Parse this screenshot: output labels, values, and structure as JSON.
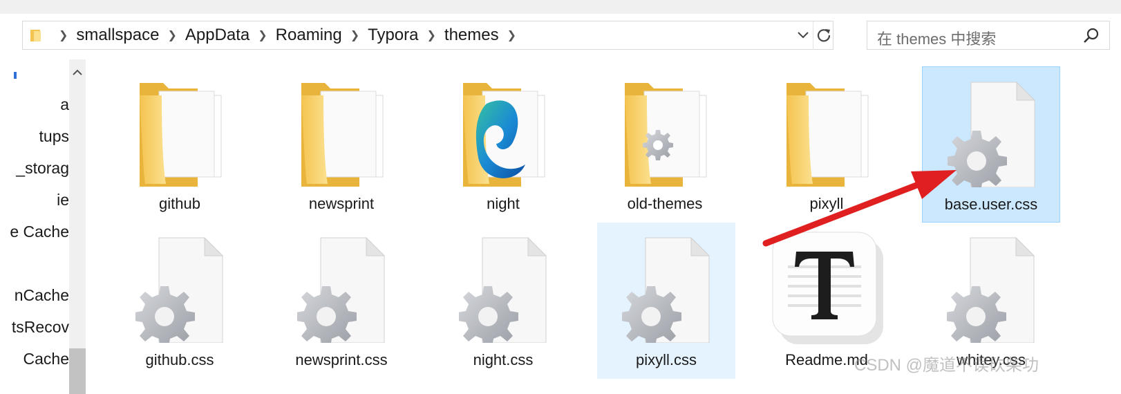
{
  "address_bar": {
    "breadcrumbs": [
      "smallspace",
      "AppData",
      "Roaming",
      "Typora",
      "themes"
    ]
  },
  "search": {
    "placeholder": "在 themes 中搜索"
  },
  "nav_pane": {
    "items": [
      "a",
      "tups",
      "_storag",
      "ie",
      "e Cache",
      "nCache",
      "tsRecov",
      "Cache"
    ]
  },
  "files": [
    {
      "name": "github",
      "type": "folder"
    },
    {
      "name": "newsprint",
      "type": "folder"
    },
    {
      "name": "night",
      "type": "folder-edge"
    },
    {
      "name": "old-themes",
      "type": "folder-css"
    },
    {
      "name": "pixyll",
      "type": "folder"
    },
    {
      "name": "base.user.css",
      "type": "css",
      "state": "selected"
    },
    {
      "name": "github.css",
      "type": "css"
    },
    {
      "name": "newsprint.css",
      "type": "css"
    },
    {
      "name": "night.css",
      "type": "css"
    },
    {
      "name": "pixyll.css",
      "type": "css",
      "state": "hover"
    },
    {
      "name": "Readme.md",
      "type": "markdown-typora"
    },
    {
      "name": "whitey.css",
      "type": "css"
    }
  ],
  "icons": {
    "folder": "folder-icon",
    "css": "css-file-gear-icon",
    "markdown": "typora-T-icon",
    "refresh": "refresh-icon",
    "search": "search-icon"
  },
  "colors": {
    "selected_bg": "#cce8ff",
    "hover_bg": "#e5f3ff",
    "folder_yellow": "#f8d775",
    "arrow_red": "#e02020"
  },
  "watermark": "CSDN @魔道不误砍柴功"
}
